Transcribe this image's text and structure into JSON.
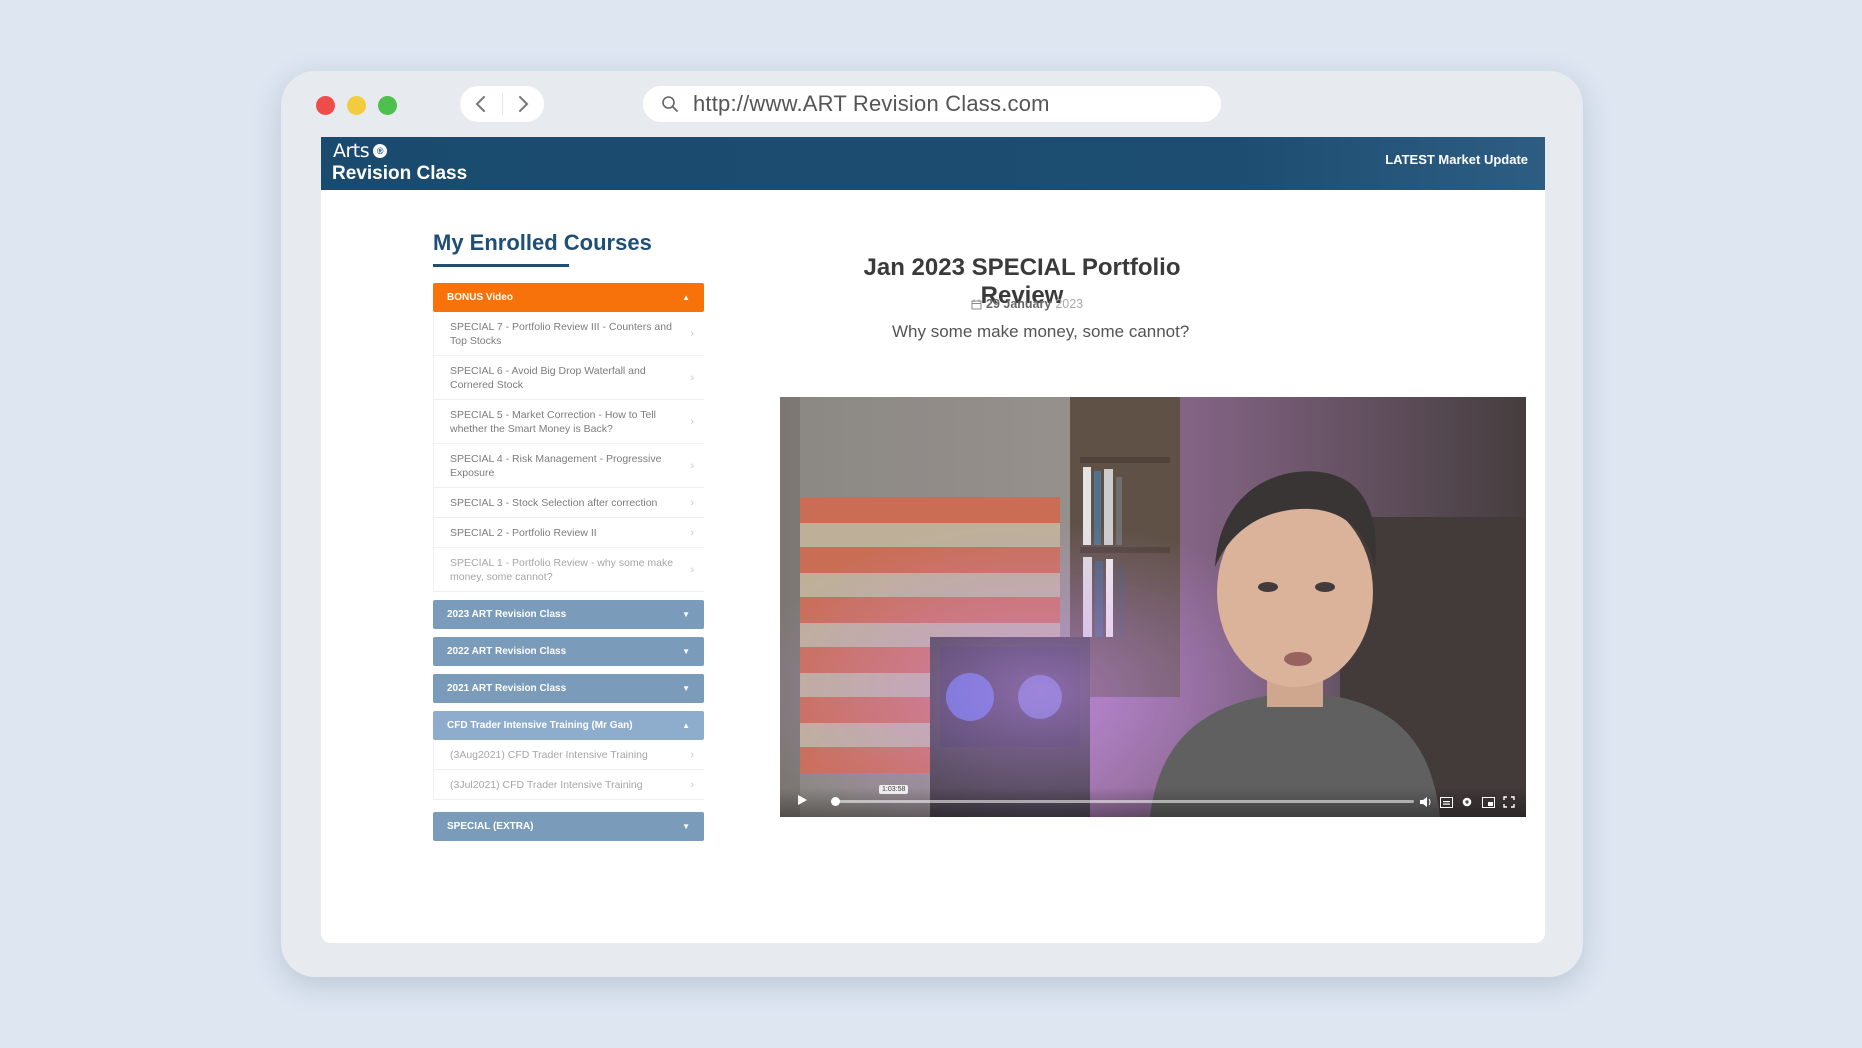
{
  "browser": {
    "url": "http://www.ART Revision Class.com"
  },
  "site": {
    "logo_text": "Arts",
    "logo_badge": "®",
    "logo_sub": "Revision Class",
    "latest_link": "LATEST Market Update"
  },
  "sidebar": {
    "title": "My Enrolled Courses",
    "bonus": {
      "label": "BONUS Video",
      "items": [
        "SPECIAL 7 - Portfolio Review III - Counters and Top Stocks",
        "SPECIAL 6 - Avoid Big Drop Waterfall and Cornered Stock",
        "SPECIAL 5 - Market Correction - How to Tell whether the Smart Money is Back?",
        "SPECIAL 4 - Risk Management - Progressive Exposure",
        "SPECIAL 3 - Stock Selection after correction",
        "SPECIAL 2 - Portfolio Review II",
        "SPECIAL 1 - Portfolio Review - why some make money, some cannot?"
      ]
    },
    "sections": [
      "2023 ART Revision Class",
      "2022 ART Revision Class",
      "2021 ART Revision Class"
    ],
    "cfd": {
      "label": "CFD Trader Intensive Training (Mr Gan)",
      "items": [
        "(3Aug2021) CFD Trader Intensive Training",
        "(3Jul2021) CFD Trader Intensive Training"
      ]
    },
    "special_extra": "SPECIAL (EXTRA)"
  },
  "main": {
    "title": "Jan 2023 SPECIAL Portfolio Review",
    "date_day": "29 January",
    "date_year": "2023",
    "subtitle": "Why some make money, some cannot?",
    "video_time": "1:03:58",
    "progress": 0
  },
  "colors": {
    "header": "#1a4b6e",
    "accent_orange": "#f7720a",
    "section_blue": "#7a9cba"
  }
}
